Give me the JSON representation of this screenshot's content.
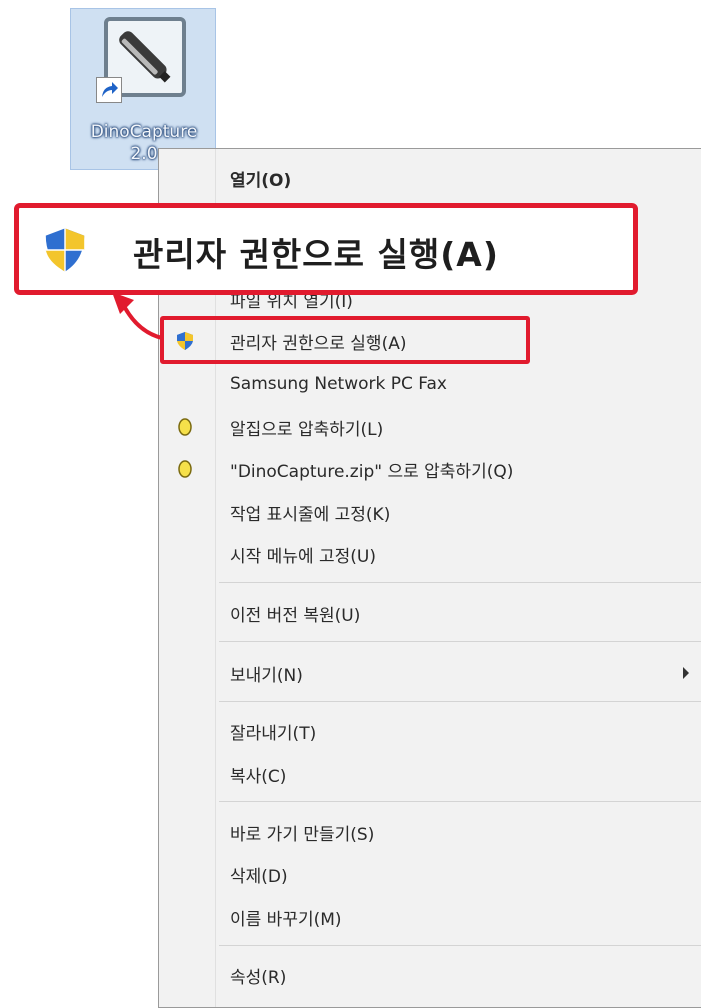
{
  "desktop_icon": {
    "name_line1": "DinoCapture",
    "name_line2": "2.0",
    "icon": "microscope-shortcut-icon"
  },
  "zoom_callout": {
    "label": "관리자 권한으로 실행(A)",
    "icon": "uac-shield-icon"
  },
  "context_menu": {
    "open": "열기(O)",
    "open_file_location": "파일 위치 열기(I)",
    "run_as_admin": "관리자 권한으로 실행(A)",
    "samsung_fax": "Samsung Network PC Fax",
    "alzip_compress": "알집으로 압축하기(L)",
    "zip_compress": "\"DinoCapture.zip\" 으로 압축하기(Q)",
    "pin_taskbar": "작업 표시줄에 고정(K)",
    "pin_start": "시작 메뉴에 고정(U)",
    "restore_previous": "이전 버전 복원(U)",
    "send_to": "보내기(N)",
    "cut": "잘라내기(T)",
    "copy": "복사(C)",
    "create_shortcut": "바로 가기 만들기(S)",
    "delete": "삭제(D)",
    "rename": "이름 바꾸기(M)",
    "properties": "속성(R)"
  },
  "colors": {
    "highlight": "#e11b2e",
    "menu_bg": "#f2f2f2",
    "icon_selection": "#cfe0f2"
  }
}
